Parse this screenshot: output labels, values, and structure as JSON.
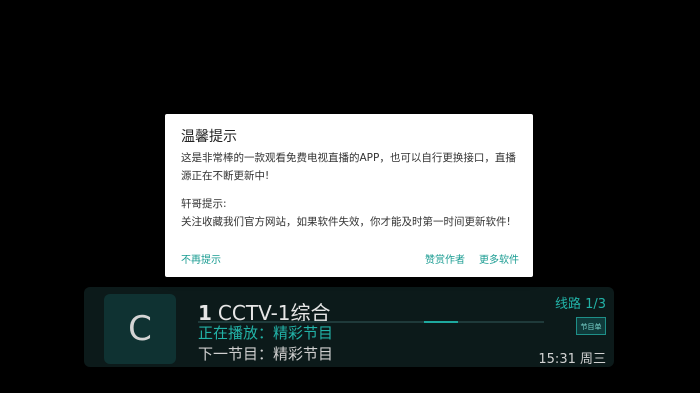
{
  "dialog": {
    "title": "温馨提示",
    "message_line": "这是非常棒的一款观看免费电视直播的APP，也可以自行更换接口，直播源正在不断更新中!",
    "section_title": "轩哥提示:",
    "section_body": "关注收藏我们官方网站，如果软件失效，你才能及时第一时间更新软件!",
    "buttons": {
      "dismiss": "不再提示",
      "tip_author": "赞赏作者",
      "more_apps": "更多软件"
    }
  },
  "channel_bar": {
    "logo_letter": "C",
    "channel_number": "1",
    "channel_name": "CCTV-1综合",
    "now_playing": "正在播放：精彩节目",
    "next_program": "下一节目：精彩节目",
    "route": "线路 1/3",
    "epg_chip": "节目单",
    "time": "15:31 周三",
    "progress": 0.75
  },
  "colors": {
    "accent": "#1a9c92",
    "background": "#000000",
    "dialog_bg": "#ffffff"
  }
}
